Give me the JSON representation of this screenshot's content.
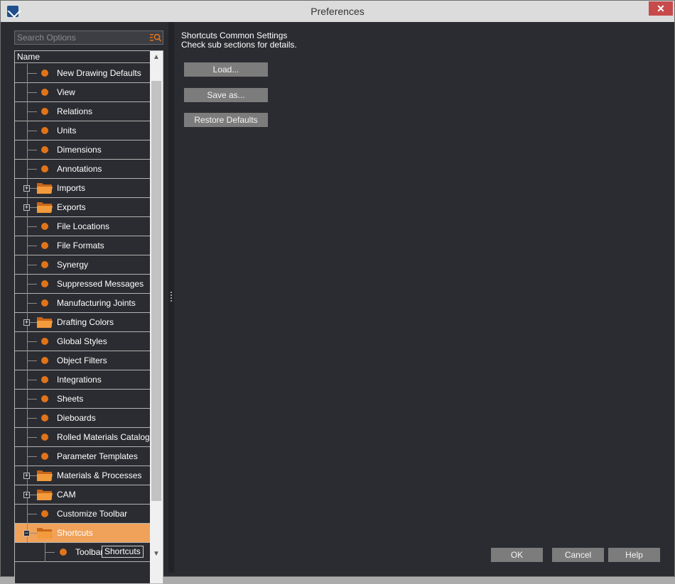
{
  "window": {
    "title": "Preferences",
    "close_label": "✕"
  },
  "search": {
    "placeholder": "Search Options"
  },
  "tree": {
    "header": "Name",
    "items": [
      {
        "label": "New Drawing Defaults",
        "kind": "leaf"
      },
      {
        "label": "View",
        "kind": "leaf"
      },
      {
        "label": "Relations",
        "kind": "leaf"
      },
      {
        "label": "Units",
        "kind": "leaf"
      },
      {
        "label": "Dimensions",
        "kind": "leaf"
      },
      {
        "label": "Annotations",
        "kind": "leaf"
      },
      {
        "label": "Imports",
        "kind": "folder"
      },
      {
        "label": "Exports",
        "kind": "folder"
      },
      {
        "label": "File Locations",
        "kind": "leaf"
      },
      {
        "label": "File Formats",
        "kind": "leaf"
      },
      {
        "label": "Synergy",
        "kind": "leaf"
      },
      {
        "label": "Suppressed Messages",
        "kind": "leaf"
      },
      {
        "label": "Manufacturing Joints",
        "kind": "leaf"
      },
      {
        "label": "Drafting Colors",
        "kind": "folder"
      },
      {
        "label": "Global Styles",
        "kind": "leaf"
      },
      {
        "label": "Object Filters",
        "kind": "leaf"
      },
      {
        "label": "Integrations",
        "kind": "leaf"
      },
      {
        "label": "Sheets",
        "kind": "leaf"
      },
      {
        "label": "Dieboards",
        "kind": "leaf"
      },
      {
        "label": "Rolled Materials Catalog",
        "kind": "leaf"
      },
      {
        "label": "Parameter Templates",
        "kind": "leaf"
      },
      {
        "label": "Materials & Processes",
        "kind": "folder"
      },
      {
        "label": "CAM",
        "kind": "folder"
      },
      {
        "label": "Customize Toolbar",
        "kind": "leaf"
      },
      {
        "label": "Shortcuts",
        "kind": "folder",
        "selected": true
      },
      {
        "label": "Toolbar",
        "kind": "child"
      }
    ],
    "tooltip": "Shortcuts"
  },
  "content": {
    "title": "Shortcuts Common Settings",
    "subtitle": "Check sub sections for details.",
    "load_label": "Load...",
    "save_label": "Save as...",
    "restore_label": "Restore Defaults"
  },
  "footer": {
    "ok_label": "OK",
    "cancel_label": "Cancel",
    "help_label": "Help"
  },
  "colors": {
    "accent_orange": "#e0741a",
    "selected_row": "#f0a25a",
    "panel_bg": "#2b2c31",
    "button_gray": "#7c7c7c"
  }
}
